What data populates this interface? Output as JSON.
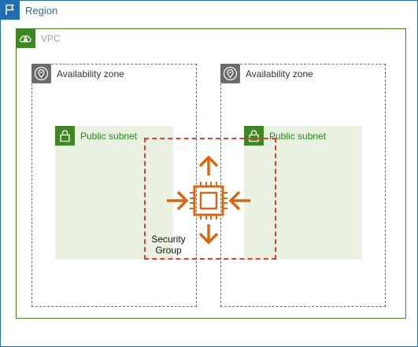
{
  "colors": {
    "region": "#1f6fb2",
    "vpc": "#3f8624",
    "availability_zone": "#6b6b6b",
    "subnet_fill": "#e9f2e1",
    "subnet_accent": "#3f8624",
    "security_group": "#e53935",
    "compute": "#d86613"
  },
  "region": {
    "label": "Region",
    "icon": "flag-icon"
  },
  "vpc": {
    "label": "VPC",
    "icon": "cloud-lock-icon"
  },
  "availability_zones": [
    {
      "label": "Availability zone",
      "icon": "map-pin-icon"
    },
    {
      "label": "Availability zone",
      "icon": "map-pin-icon"
    }
  ],
  "subnets": [
    {
      "label": "Public subnet",
      "icon": "lock-icon"
    },
    {
      "label": "Public subnet",
      "icon": "lock-icon"
    }
  ],
  "security_group": {
    "label_line1": "Security",
    "label_line2": "Group"
  },
  "compute": {
    "icon": "auto-scaling-instance-icon",
    "arrow_icons": [
      "arrow-up-icon",
      "arrow-down-icon",
      "arrow-left-icon",
      "arrow-right-icon"
    ]
  }
}
